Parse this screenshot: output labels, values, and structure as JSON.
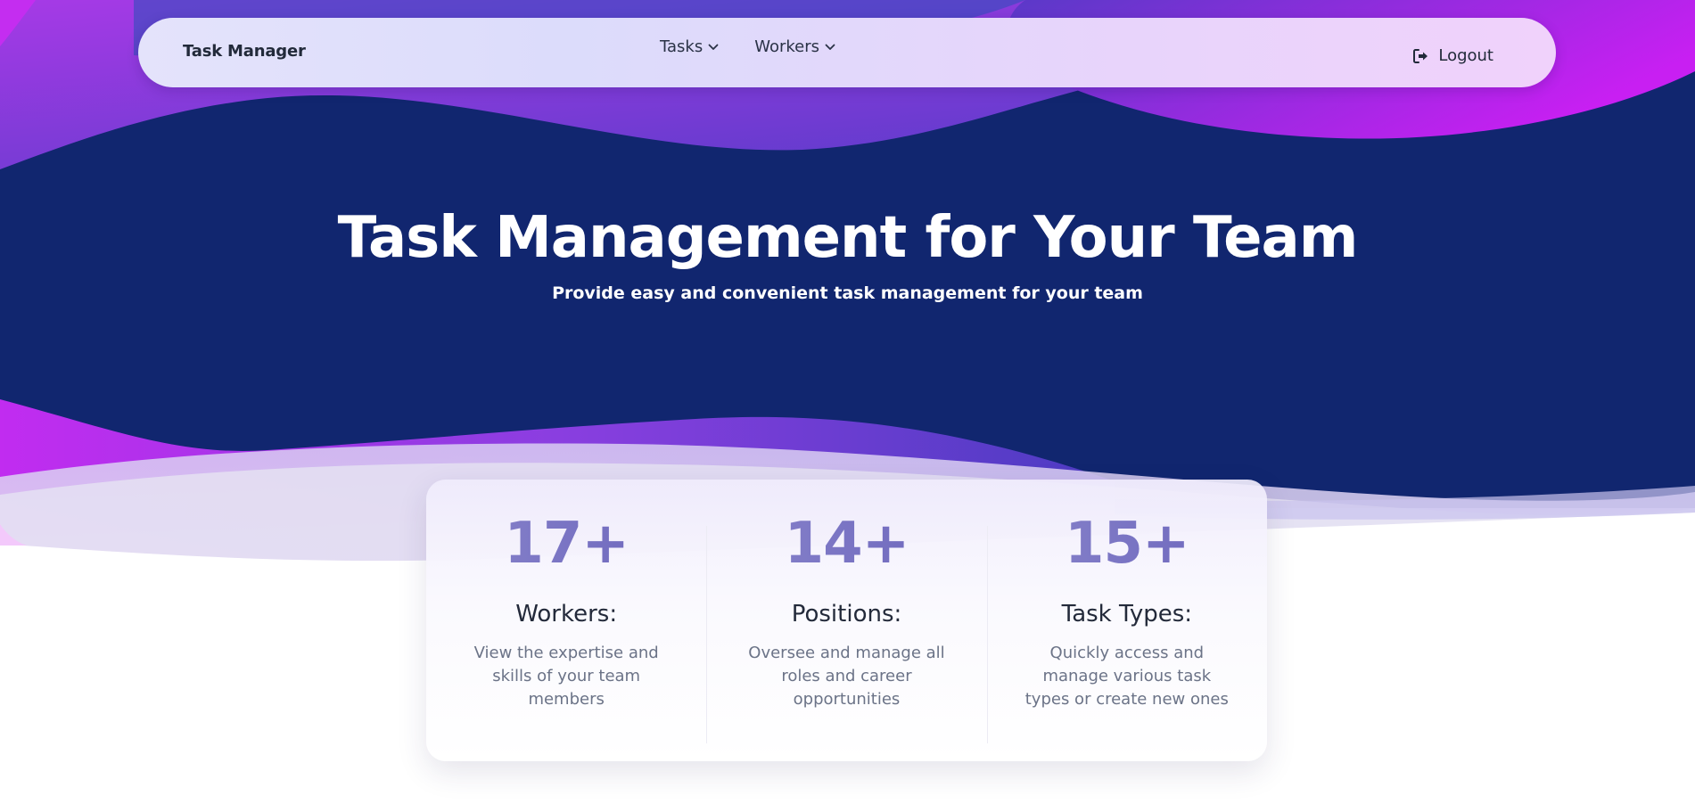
{
  "colors": {
    "navy": "#11266f",
    "purple": "#8a3ad6",
    "magenta": "#c023f0",
    "stat_number": "#6a63bb"
  },
  "navbar": {
    "brand": "Task Manager",
    "menu": [
      {
        "label": "Tasks",
        "icon": "chevron-down-icon"
      },
      {
        "label": "Workers",
        "icon": "chevron-down-icon"
      }
    ],
    "logout": {
      "label": "Logout",
      "icon": "sign-out-icon"
    }
  },
  "hero": {
    "title": "Task Management for Your Team",
    "subtitle": "Provide easy and convenient task management for your team"
  },
  "stats": [
    {
      "number": "17+",
      "title": "Workers:",
      "description": "View the expertise and skills of your team members"
    },
    {
      "number": "14+",
      "title": "Positions:",
      "description": "Oversee and manage all roles and career opportunities"
    },
    {
      "number": "15+",
      "title": "Task Types:",
      "description": "Quickly access and manage various task types or create new ones"
    }
  ]
}
